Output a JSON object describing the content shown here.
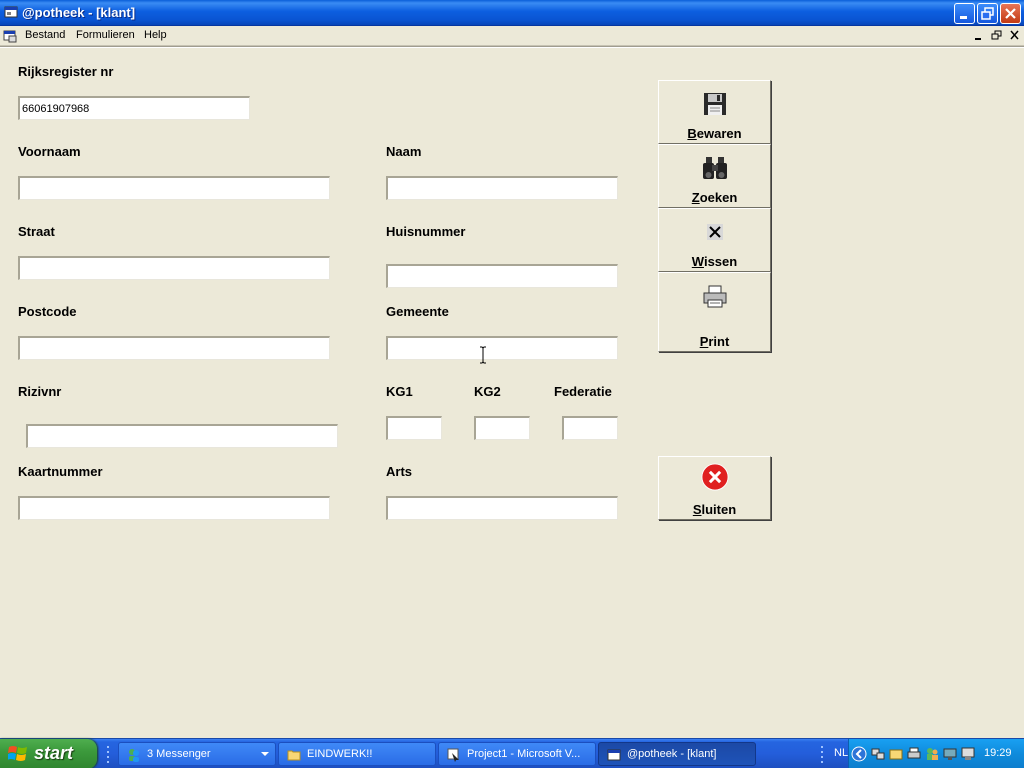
{
  "window": {
    "title": "@potheek - [klant]"
  },
  "menu": {
    "items": [
      "Bestand",
      "Formulieren",
      "Help"
    ]
  },
  "form": {
    "rijksregister": {
      "label": "Rijksregister nr",
      "value": "66061907968"
    },
    "voornaam": {
      "label": "Voornaam",
      "value": ""
    },
    "naam": {
      "label": "Naam",
      "value": ""
    },
    "straat": {
      "label": "Straat",
      "value": ""
    },
    "huisnummer": {
      "label": "Huisnummer",
      "value": ""
    },
    "postcode": {
      "label": "Postcode",
      "value": ""
    },
    "gemeente": {
      "label": "Gemeente",
      "value": ""
    },
    "rizivnr": {
      "label": "Rizivnr",
      "value": ""
    },
    "kg1": {
      "label": "KG1",
      "value": ""
    },
    "kg2": {
      "label": "KG2",
      "value": ""
    },
    "federatie": {
      "label": "Federatie",
      "value": ""
    },
    "kaartnummer": {
      "label": "Kaartnummer",
      "value": ""
    },
    "arts": {
      "label": "Arts",
      "value": ""
    }
  },
  "buttons": {
    "bewaren": {
      "first": "B",
      "rest": "ewaren",
      "icon": "floppy-disk-icon"
    },
    "zoeken": {
      "first": "Z",
      "rest": "oeken",
      "icon": "binoculars-icon"
    },
    "wissen": {
      "first": "W",
      "rest": "issen",
      "icon": "clear-x-icon"
    },
    "print": {
      "first": "P",
      "rest": "rint",
      "icon": "printer-icon"
    },
    "sluiten": {
      "first": "S",
      "rest": "luiten",
      "icon": "close-circle-icon"
    }
  },
  "taskbar": {
    "start_label": "start",
    "tasks": [
      {
        "label": "3 Messenger",
        "icon": "messenger-icon"
      },
      {
        "label": "EINDWERK!!",
        "icon": "folder-icon"
      },
      {
        "label": "Project1 - Microsoft V...",
        "icon": "vb-project-icon"
      },
      {
        "label": "@potheek - [klant]",
        "icon": "app-window-icon"
      }
    ],
    "language": "NL",
    "clock": "19:29"
  },
  "colors": {
    "titlebar": "#0a54d2",
    "face": "#ece9d8",
    "start_green": "#3c9a3c",
    "close_red": "#e02020"
  }
}
